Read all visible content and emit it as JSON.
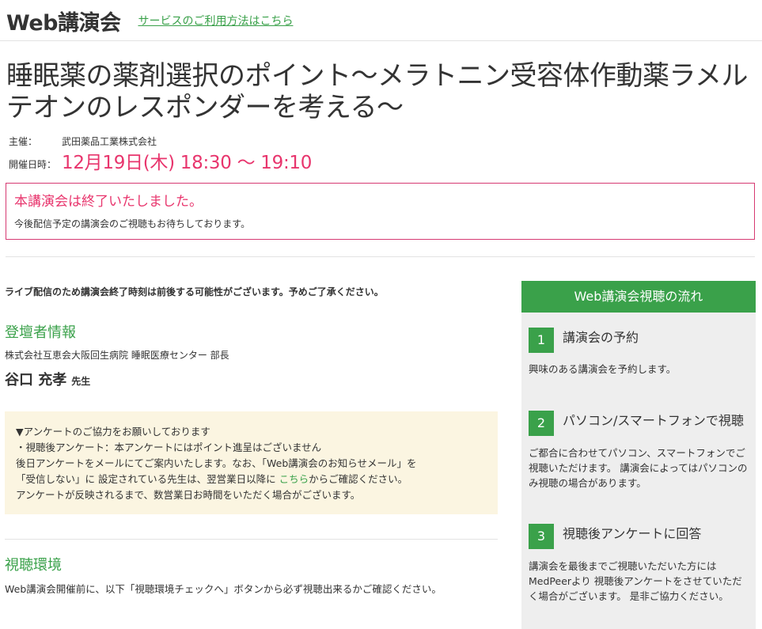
{
  "header": {
    "brand": "Web講演会",
    "help_link": "サービスのご利用方法はこちら"
  },
  "event": {
    "title": "睡眠薬の薬剤選択のポイント～メラトニン受容体作動薬ラメルテオンのレスポンダーを考える～",
    "organizer_label": "主催：",
    "organizer": "武田薬品工業株式会社",
    "date_label": "開催日時：",
    "date": "12月19日(木) 18:30 ～ 19:10"
  },
  "notice": {
    "ended_title": "本講演会は終了いたしました。",
    "ended_text": "今後配信予定の講演会のご視聴もお待ちしております。"
  },
  "live_note": "ライブ配信のため講演会終了時刻は前後する可能性がございます。予めご了承ください。",
  "speaker": {
    "section_title": "登壇者情報",
    "affiliation": "株式会社互恵会大阪回生病院 睡眠医療センター 部長",
    "name": "谷口 充孝",
    "honorific": "先生"
  },
  "survey": {
    "line1": "▼アンケートのご協力をお願いしております",
    "line2": "・視聴後アンケート：本アンケートにはポイント進呈はございません",
    "line3": "後日アンケートをメールにてご案内いたします。なお、「Web講演会のお知らせメール」を",
    "line4_pre": "「受信しない」に 設定されている先生は、翌営業日以降に ",
    "line4_link": "こちら",
    "line4_post": "からご確認ください。",
    "line5": "アンケートが反映されるまで、数営業日お時間をいただく場合がございます。"
  },
  "environment": {
    "section_title": "視聴環境",
    "text": "Web講演会開催前に、以下「視聴環境チェックへ」ボタンから必ず視聴出来るかご確認ください。"
  },
  "sidebar": {
    "title": "Web講演会視聴の流れ",
    "steps": [
      {
        "num": "1",
        "title": "講演会の予約",
        "desc": "興味のある講演会を予約します。"
      },
      {
        "num": "2",
        "title": "パソコン/スマートフォンで視聴",
        "desc": "ご都合に合わせてパソコン、スマートフォンでご視聴いただけます。 講演会によってはパソコンのみ視聴の場合があります。"
      },
      {
        "num": "3",
        "title": "視聴後アンケートに回答",
        "desc": "講演会を最後までご視聴いただいた方にはMedPeerより 視聴後アンケートをさせていただく場合がございます。 是非ご協力ください。"
      }
    ]
  },
  "colors": {
    "accent_green": "#3aa14a",
    "alert_pink": "#e8356d",
    "survey_bg": "#fbf5e1",
    "sidebar_bg": "#eeeeee"
  }
}
